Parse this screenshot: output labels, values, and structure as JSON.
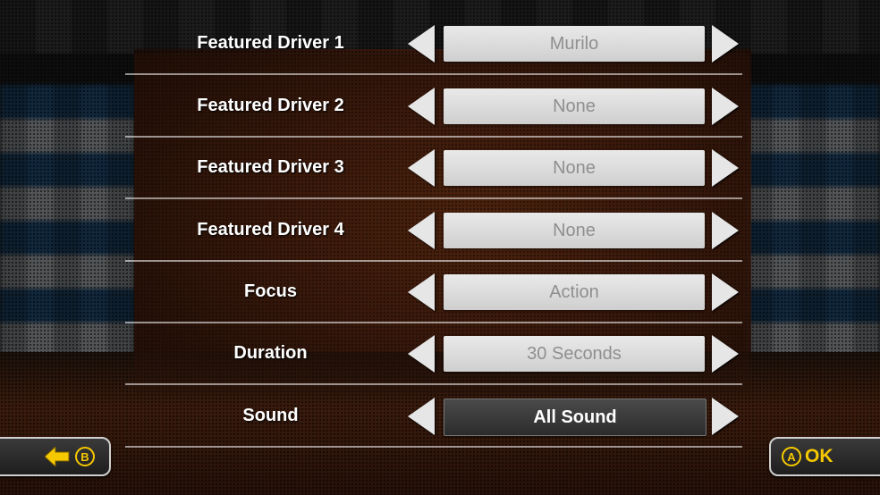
{
  "settings": [
    {
      "label": "Featured Driver 1",
      "value": "Murilo",
      "selected": false
    },
    {
      "label": "Featured Driver 2",
      "value": "None",
      "selected": false
    },
    {
      "label": "Featured Driver 3",
      "value": "None",
      "selected": false
    },
    {
      "label": "Featured Driver 4",
      "value": "None",
      "selected": false
    },
    {
      "label": "Focus",
      "value": "Action",
      "selected": false
    },
    {
      "label": "Duration",
      "value": "30 Seconds",
      "selected": false
    },
    {
      "label": "Sound",
      "value": "All Sound",
      "selected": true
    }
  ],
  "buttons": {
    "back": {
      "glyph": "B",
      "icon": "left-arrow-icon"
    },
    "ok": {
      "glyph": "A",
      "label": "OK"
    }
  },
  "colors": {
    "accent_yellow": "#f5c800",
    "value_box": "#d9d9d9",
    "value_text": "#8f8f8f",
    "selected_box": "#333333"
  }
}
